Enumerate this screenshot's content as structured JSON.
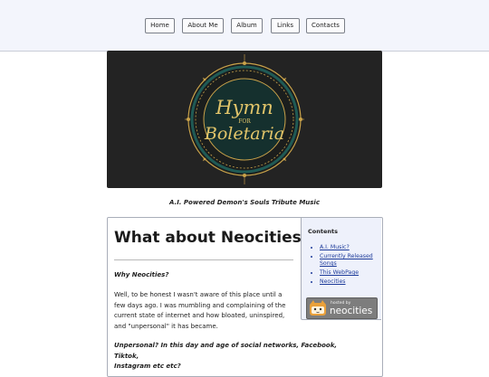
{
  "nav": {
    "items": [
      {
        "label": "Home"
      },
      {
        "label": "About Me"
      },
      {
        "label": "Album"
      },
      {
        "label": "Links"
      },
      {
        "label": "Contacts"
      }
    ]
  },
  "banner": {
    "logo_line1": "Hymn",
    "logo_line2": "FOR",
    "logo_line3": "Boletaria",
    "caption": "A.I. Powered Demon's Souls Tribute Music"
  },
  "article": {
    "title": "What about Neocities?",
    "question1": "Why Neocities?",
    "paragraph1_lines": [
      "Well, to be honest I wasn't aware of this place until a",
      "few days ago. I was mumbling and complaining of the",
      "current state of internet and how bloated, uninspired,",
      "and \"unpersonal\" it has became."
    ],
    "question2_lines": [
      "Unpersonal? In this day and age of social networks, Facebook, Tiktok,",
      "Instagram etc etc?"
    ]
  },
  "toc": {
    "title": "Contents",
    "items": [
      {
        "lines": [
          "A.I. Music?"
        ]
      },
      {
        "lines": [
          "Currently Released",
          "Songs"
        ]
      },
      {
        "lines": [
          "This WebPage"
        ]
      },
      {
        "lines": [
          "Neocities"
        ]
      }
    ]
  },
  "badge": {
    "small_text": "hosted by",
    "big_text": "neocities"
  },
  "colors": {
    "topbar": "#f3f5fc",
    "link": "#1d3b9a",
    "toc_bg": "#eef1fb",
    "banner_bg": "#232323",
    "logo_gold": "#c9a24a",
    "logo_teal": "#1f5a55"
  }
}
